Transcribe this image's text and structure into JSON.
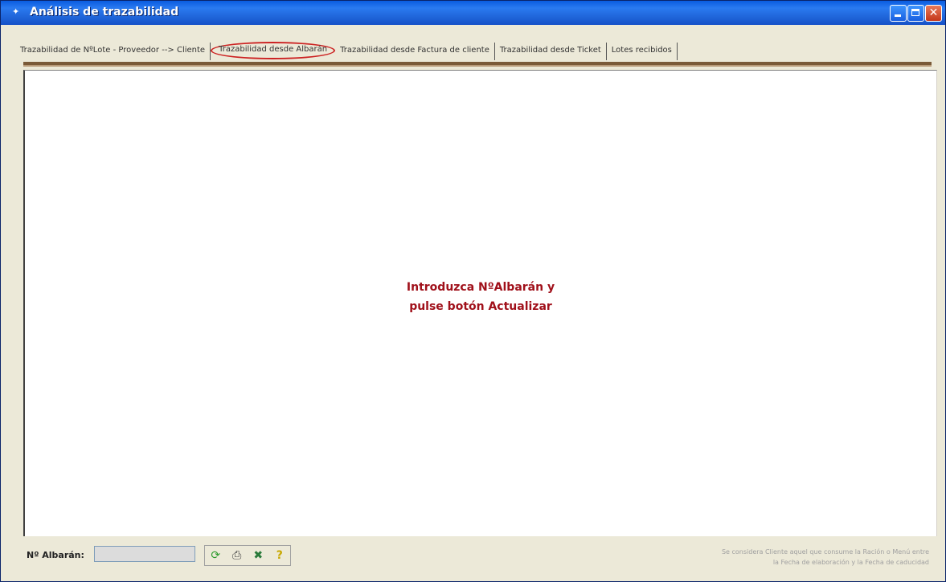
{
  "window": {
    "title": "Análisis de trazabilidad"
  },
  "tabs": [
    {
      "label": "Trazabilidad de NºLote - Proveedor --> Cliente"
    },
    {
      "label": "Trazabilidad desde Albarán"
    },
    {
      "label": "Trazabilidad desde Factura de cliente"
    },
    {
      "label": "Trazabilidad desde Ticket"
    },
    {
      "label": "Lotes recibidos"
    }
  ],
  "panel": {
    "message_line1": "Introduzca NºAlbarán y",
    "message_line2": "pulse botón Actualizar"
  },
  "bottom": {
    "albaran_label": "Nº Albarán:",
    "albaran_value": "",
    "note_line1": "Se considera Cliente aquel que consume la Ración o Menú entre",
    "note_line2": "la Fecha de elaboración y la Fecha de caducidad"
  },
  "icons": {
    "refresh": "refresh-icon",
    "print": "print-icon",
    "excel": "excel-icon",
    "help": "help-icon"
  },
  "colors": {
    "message": "#a0101a",
    "active_tab_outline": "#cc2222",
    "titlebar": "#1f64d8"
  }
}
